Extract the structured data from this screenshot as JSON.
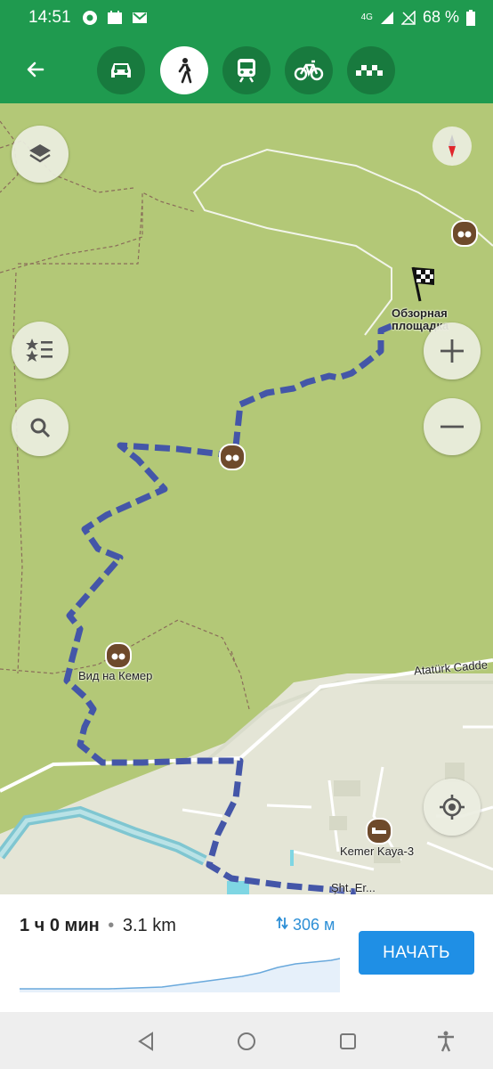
{
  "status_bar": {
    "time": "14:51",
    "network": "4G",
    "battery": "68 %"
  },
  "transport_modes": [
    {
      "name": "car",
      "active": false
    },
    {
      "name": "walk",
      "active": true
    },
    {
      "name": "transit",
      "active": false
    },
    {
      "name": "bike",
      "active": false
    },
    {
      "name": "taxi",
      "active": false
    }
  ],
  "map": {
    "destination_label_line1": "Обзорная",
    "destination_label_line2": "площадка",
    "poi_view_label": "Вид на Кемер",
    "road_label": "Atatürk Cadde",
    "place_label": "Kemer Kaya-3",
    "street_label": "Şht. Er..."
  },
  "route_summary": {
    "duration": "1 ч 0 мин",
    "separator": "•",
    "distance": "3.1 km",
    "elevation": "306 м",
    "start_label": "НАЧАТЬ"
  },
  "colors": {
    "header_green": "#1f9a4f",
    "route_blue": "#4456a8",
    "start_blue": "#1f8fe5",
    "map_green": "#b3c877"
  }
}
